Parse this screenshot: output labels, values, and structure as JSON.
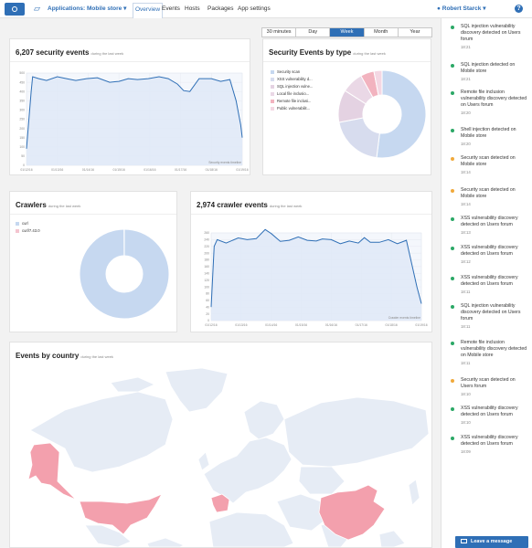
{
  "header": {
    "app_label": "Applications: Mobile store",
    "nav": [
      "Overview",
      "Events",
      "Hosts",
      "Packages",
      "App settings"
    ],
    "user": "Robert Starck",
    "help": "?"
  },
  "time_filter": {
    "options": [
      "30 minutes",
      "Day",
      "Week",
      "Month",
      "Year"
    ],
    "selected": "Week"
  },
  "panels": {
    "security_events": {
      "title": "6,207 security events",
      "subtitle": "during the last week",
      "timeline_label": "Security events timeline"
    },
    "events_by_type": {
      "title": "Security Events by type",
      "subtitle": "during the last week"
    },
    "crawlers": {
      "title": "Crawlers",
      "subtitle": "during the last week"
    },
    "crawler_events": {
      "title": "2,974 crawler events",
      "subtitle": "during the last week",
      "timeline_label": "Crawler events timeline"
    },
    "events_by_country": {
      "title": "Events by country",
      "subtitle": "during the last week"
    }
  },
  "chart_data": [
    {
      "type": "area",
      "x": [
        "01/12/16",
        "01/13/16",
        "01/14/16",
        "01/15/16",
        "01/16/16",
        "01/17/16",
        "01/18/16",
        "01/19/16"
      ],
      "y_ticks": [
        "0",
        "50",
        "100",
        "150",
        "200",
        "250",
        "300",
        "350",
        "400",
        "450",
        "500"
      ],
      "ylim": [
        0,
        500
      ],
      "series": [
        {
          "values_x": [
            0,
            0.15,
            0.2,
            0.4,
            0.65,
            1.0,
            1.3,
            1.6,
            1.95,
            2.3,
            2.7,
            3.0,
            3.3,
            3.6,
            3.95,
            4.3,
            4.6,
            4.9,
            5.1,
            5.3,
            5.6,
            6.0,
            6.3,
            6.6,
            6.8,
            6.95,
            7.0
          ],
          "values_y": [
            90,
            400,
            480,
            470,
            460,
            480,
            470,
            460,
            470,
            475,
            450,
            455,
            470,
            465,
            470,
            480,
            470,
            440,
            405,
            400,
            470,
            470,
            455,
            465,
            350,
            220,
            150
          ]
        }
      ]
    },
    {
      "type": "pie",
      "slices": [
        {
          "label": "Security scan",
          "value": 52,
          "color": "#c6d8f0"
        },
        {
          "label": "XSS vulnerability d...",
          "value": 20,
          "color": "#d7dcee"
        },
        {
          "label": "SQL injection vulne...",
          "value": 12,
          "color": "#e4d2e2"
        },
        {
          "label": "Local file inclusio...",
          "value": 8,
          "color": "#ead8e6"
        },
        {
          "label": "Remote file inclusi...",
          "value": 5,
          "color": "#f2b3bf"
        },
        {
          "label": "Public vulnerabilit...",
          "value": 3,
          "color": "#f4d7e3"
        }
      ]
    },
    {
      "type": "pie",
      "slices": [
        {
          "label": "curl",
          "value": 99.9,
          "color": "#c6d8f0"
        },
        {
          "label": "curl/7.43.0",
          "value": 0.1,
          "color": "#f4c4cf"
        }
      ]
    },
    {
      "type": "area",
      "x": [
        "01/12/16",
        "01/13/16",
        "01/14/16",
        "01/15/16",
        "01/16/16",
        "01/17/16",
        "01/18/16",
        "01/19/16"
      ],
      "y_ticks": [
        "0",
        "20",
        "40",
        "60",
        "80",
        "100",
        "120",
        "140",
        "160",
        "180",
        "200",
        "220",
        "240",
        "260"
      ],
      "ylim": [
        0,
        260
      ],
      "series": [
        {
          "values_x": [
            0,
            0.1,
            0.2,
            0.5,
            0.9,
            1.2,
            1.5,
            1.8,
            2.0,
            2.3,
            2.6,
            2.9,
            3.2,
            3.5,
            3.7,
            4.0,
            4.3,
            4.6,
            4.9,
            5.1,
            5.3,
            5.6,
            5.9,
            6.2,
            6.5,
            6.7,
            6.85,
            7.0
          ],
          "values_y": [
            40,
            220,
            240,
            230,
            245,
            240,
            243,
            270,
            258,
            235,
            238,
            248,
            238,
            236,
            242,
            240,
            228,
            236,
            230,
            246,
            232,
            232,
            240,
            228,
            238,
            160,
            100,
            50
          ]
        }
      ]
    }
  ],
  "map": {
    "highlighted": [
      "Alaska",
      "United States",
      "France",
      "China"
    ],
    "highlight_color": "#f3a0ad",
    "land_color": "#e6ecf5"
  },
  "legends": {
    "events_by_type": [
      "Security scan",
      "XSS vulnerability d...",
      "SQL injection vulne...",
      "Local file inclusio...",
      "Remote file inclusi...",
      "Public vulnerabilit..."
    ],
    "crawlers": [
      "curl",
      "curl/7.43.0"
    ]
  },
  "feed": [
    {
      "text": "SQL injection vulnerability discovery detected on Users forum",
      "time": "18:21",
      "color": "#2ba866"
    },
    {
      "text": "SQL injection detected on Mobile store",
      "time": "18:21",
      "color": "#2ba866"
    },
    {
      "text": "Remote file inclusion vulnerability discovery detected on Users forum",
      "time": "18:20",
      "color": "#2ba866"
    },
    {
      "text": "Shell injection detected on Mobile store",
      "time": "18:20",
      "color": "#2ba866"
    },
    {
      "text": "Security scan detected on Mobile store",
      "time": "18:14",
      "color": "#f0a93b"
    },
    {
      "text": "Security scan detected on Mobile store",
      "time": "18:14",
      "color": "#f0a93b"
    },
    {
      "text": "XSS vulnerability discovery detected on Users forum",
      "time": "18:13",
      "color": "#2ba866"
    },
    {
      "text": "XSS vulnerability discovery detected on Users forum",
      "time": "18:12",
      "color": "#2ba866"
    },
    {
      "text": "XSS vulnerability discovery detected on Users forum",
      "time": "18:11",
      "color": "#2ba866"
    },
    {
      "text": "SQL injection vulnerability discovery detected on Users forum",
      "time": "18:11",
      "color": "#2ba866"
    },
    {
      "text": "Remote file inclusion vulnerability discovery detected on Mobile store",
      "time": "18:11",
      "color": "#2ba866"
    },
    {
      "text": "Security scan detected on Users forum",
      "time": "18:10",
      "color": "#f0a93b"
    },
    {
      "text": "XSS vulnerability discovery detected on Users forum",
      "time": "18:10",
      "color": "#2ba866"
    },
    {
      "text": "XSS vulnerability discovery detected on Users forum",
      "time": "18:09",
      "color": "#2ba866"
    }
  ],
  "leave_message": "Leave a message"
}
